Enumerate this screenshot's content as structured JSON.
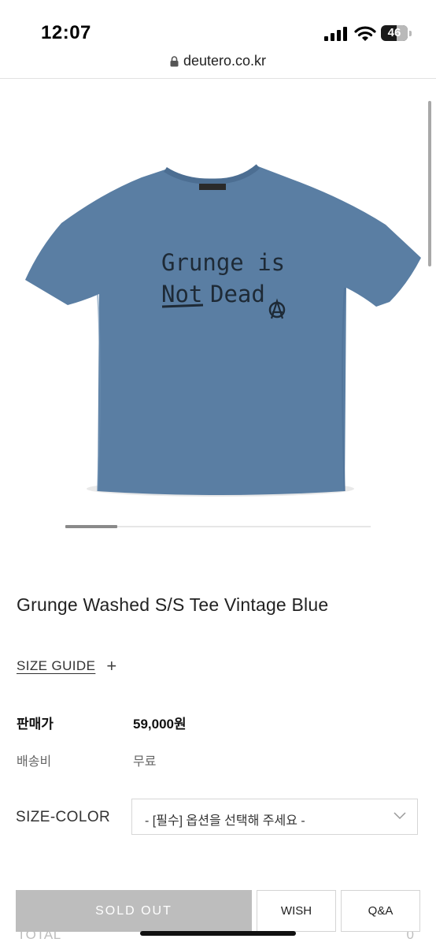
{
  "status_bar": {
    "time": "12:07",
    "battery_level": "46"
  },
  "browser": {
    "url": "deutero.co.kr"
  },
  "gallery": {
    "image": "blue-tshirt-image",
    "active_index_fraction": 0.17
  },
  "product": {
    "title": "Grunge Washed S/S Tee Vintage Blue",
    "size_guide_label": "SIZE GUIDE",
    "price_label": "판매가",
    "price_value": "59,000원",
    "shipping_label": "배송비",
    "shipping_value": "무료",
    "option_label": "SIZE-COLOR",
    "option_placeholder": "- [필수] 옵션을 선택해 주세요 -"
  },
  "shirt_print": {
    "line1": "Grunge is",
    "line2_part1": "Not",
    "line2_part2": "Dead"
  },
  "total": {
    "label": "TOTAL",
    "value": "0"
  },
  "actions": {
    "sold_out": "SOLD OUT",
    "wish": "WISH",
    "qna": "Q&A"
  },
  "colors": {
    "shirt_blue": "#5a7ea3",
    "sold_out_bg": "#bdbdbd"
  }
}
